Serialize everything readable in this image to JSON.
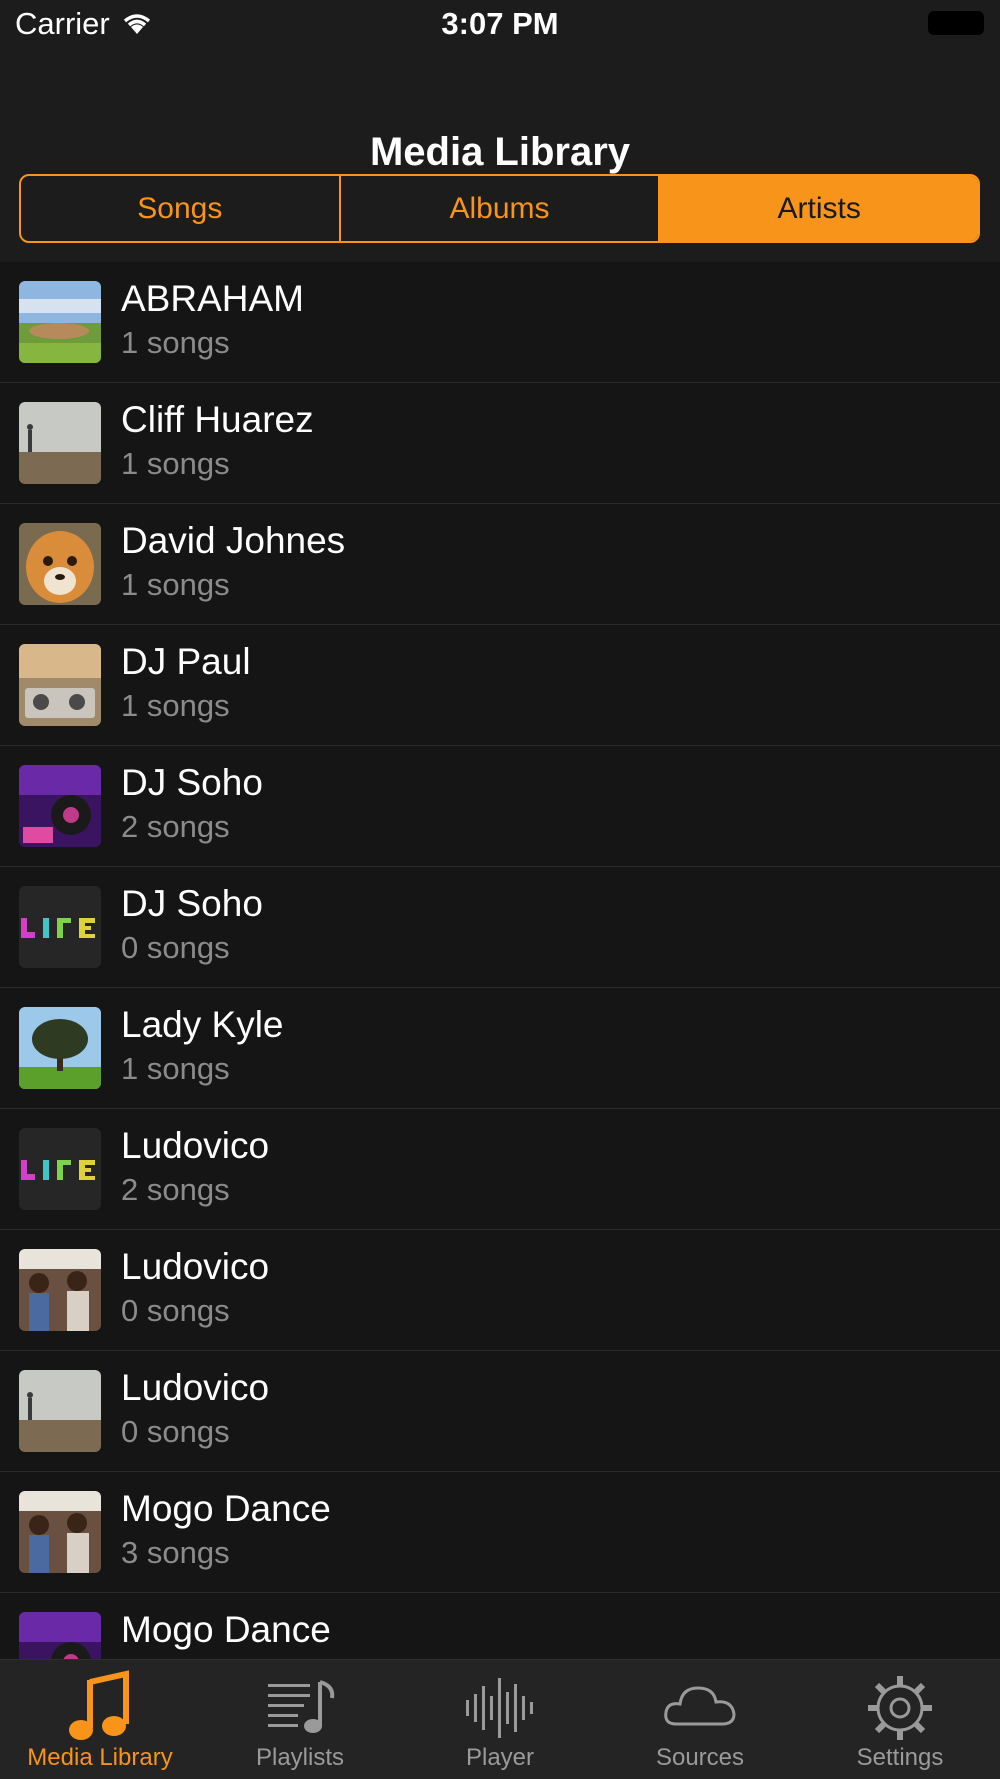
{
  "status_bar": {
    "carrier": "Carrier",
    "time": "3:07 PM"
  },
  "nav": {
    "title": "Media Library"
  },
  "segments": [
    {
      "label": "Songs",
      "active": false
    },
    {
      "label": "Albums",
      "active": false
    },
    {
      "label": "Artists",
      "active": true
    }
  ],
  "artists": [
    {
      "name": "ABRAHAM",
      "count": "1 songs",
      "artwork": "landscape-village"
    },
    {
      "name": "Cliff Huarez",
      "count": "1 songs",
      "artwork": "foggy-field-person"
    },
    {
      "name": "David Johnes",
      "count": "1 songs",
      "artwork": "cheetah-cub"
    },
    {
      "name": "DJ Paul",
      "count": "1 songs",
      "artwork": "dj-mixer-crowd"
    },
    {
      "name": "DJ Soho",
      "count": "2 songs",
      "artwork": "dj-turntable-purple"
    },
    {
      "name": "DJ Soho",
      "count": "0 songs",
      "artwork": "life-neon-text"
    },
    {
      "name": "Lady Kyle",
      "count": "1 songs",
      "artwork": "tree-on-hill"
    },
    {
      "name": "Ludovico",
      "count": "2 songs",
      "artwork": "life-neon-text"
    },
    {
      "name": "Ludovico",
      "count": "0 songs",
      "artwork": "crowd-people"
    },
    {
      "name": "Ludovico",
      "count": "0 songs",
      "artwork": "foggy-field-person"
    },
    {
      "name": "Mogo Dance",
      "count": "3 songs",
      "artwork": "crowd-people"
    },
    {
      "name": "Mogo Dance",
      "count": "",
      "artwork": "dj-turntable-purple"
    }
  ],
  "tabs": [
    {
      "label": "Media Library",
      "icon": "music-note-icon",
      "active": true
    },
    {
      "label": "Playlists",
      "icon": "playlist-icon",
      "active": false
    },
    {
      "label": "Player",
      "icon": "waveform-icon",
      "active": false
    },
    {
      "label": "Sources",
      "icon": "cloud-icon",
      "active": false
    },
    {
      "label": "Settings",
      "icon": "gear-icon",
      "active": false
    }
  ],
  "colors": {
    "accent": "#f8941a",
    "background": "#151515",
    "bar": "#1c1c1c",
    "secondary_text": "#8b8b8b"
  }
}
